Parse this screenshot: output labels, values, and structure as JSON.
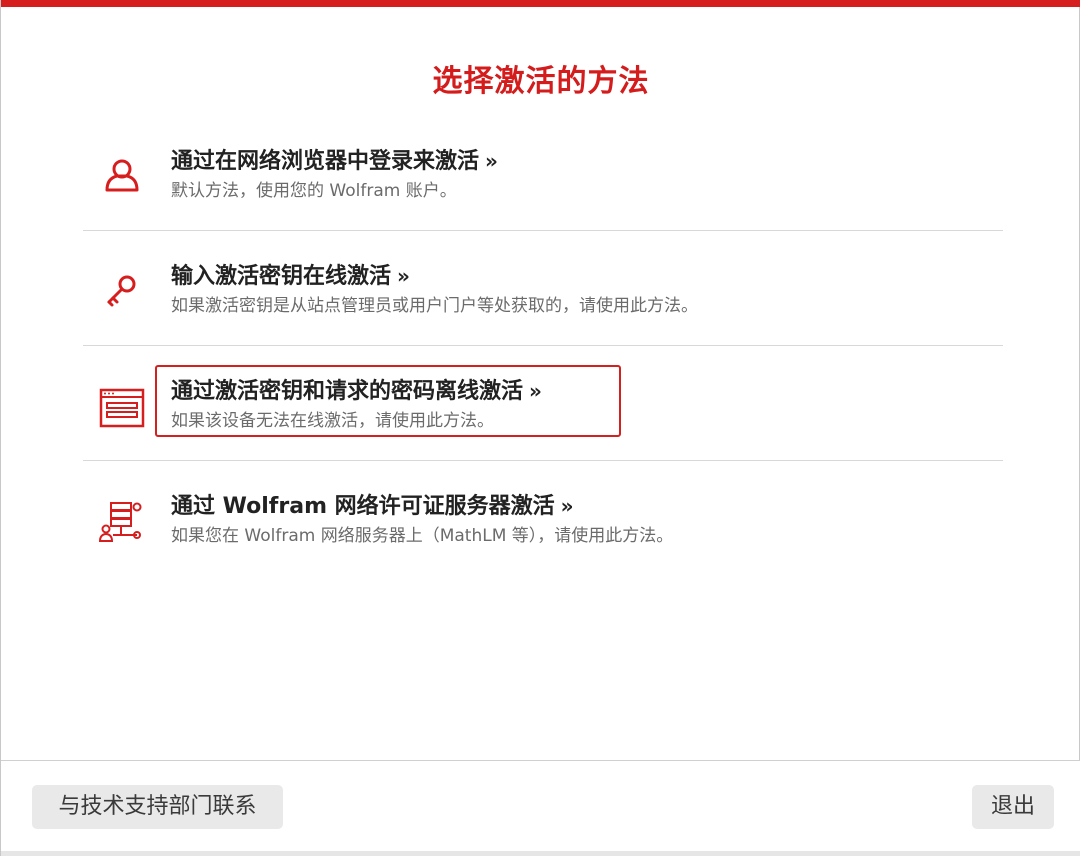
{
  "header": {
    "title": "选择激活的方法"
  },
  "options": [
    {
      "title": "通过在网络浏览器中登录来激活",
      "chevron": "»",
      "description": "默认方法，使用您的 Wolfram 账户。",
      "icon": "user-icon"
    },
    {
      "title": "输入激活密钥在线激活",
      "chevron": "»",
      "description": "如果激活密钥是从站点管理员或用户门户等处获取的，请使用此方法。",
      "icon": "key-icon"
    },
    {
      "title": "通过激活密钥和请求的密码离线激活",
      "chevron": "»",
      "description": "如果该设备无法在线激活，请使用此方法。",
      "icon": "window-form-icon",
      "highlighted": true
    },
    {
      "title": "通过 Wolfram 网络许可证服务器激活",
      "chevron": "»",
      "description": "如果您在 Wolfram 网络服务器上（MathLM 等），请使用此方法。",
      "icon": "network-server-icon"
    }
  ],
  "footer": {
    "support_label": "与技术支持部门联系",
    "exit_label": "退出"
  },
  "colors": {
    "accent": "#d71e1e",
    "title_text": "#222222",
    "desc_text": "#6b6b6b",
    "button_bg": "#e9e9e9"
  }
}
